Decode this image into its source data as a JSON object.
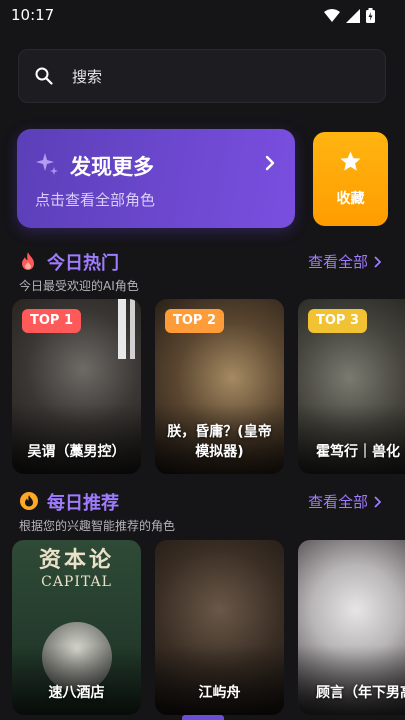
{
  "status": {
    "time": "10:17"
  },
  "search": {
    "placeholder": "搜索"
  },
  "discover": {
    "title": "发现更多",
    "subtitle": "点击查看全部角色"
  },
  "favorite": {
    "label": "收藏"
  },
  "hot": {
    "title": "今日热门",
    "subtitle": "今日最受欢迎的AI角色",
    "see_all": "查看全部",
    "items": [
      {
        "rank": "TOP 1",
        "name": "吴谓（藁男控）",
        "badge_color": "#ff5a5a"
      },
      {
        "rank": "TOP 2",
        "name": "朕，昏庸？(皇帝模拟器)",
        "badge_color": "#ff9c3a"
      },
      {
        "rank": "TOP 3",
        "name": "霍笃行｜兽化｜雇佣兵",
        "badge_color": "#f1c233"
      }
    ]
  },
  "daily": {
    "title": "每日推荐",
    "subtitle": "根据您的兴趣智能推荐的角色",
    "see_all": "查看全部",
    "items": [
      {
        "name": "速八酒店",
        "cover_text_cn": "资本论",
        "cover_text_en": "CAPITAL"
      },
      {
        "name": "江屿舟"
      },
      {
        "name": "顾言（年下男高）"
      }
    ]
  },
  "colors": {
    "accent": "#9f7cff",
    "discover_bg": "#6a46cf",
    "favorite_bg": "#ffa800",
    "hot_icon": "#ff5a5a",
    "daily_icon": "#ffa726"
  }
}
